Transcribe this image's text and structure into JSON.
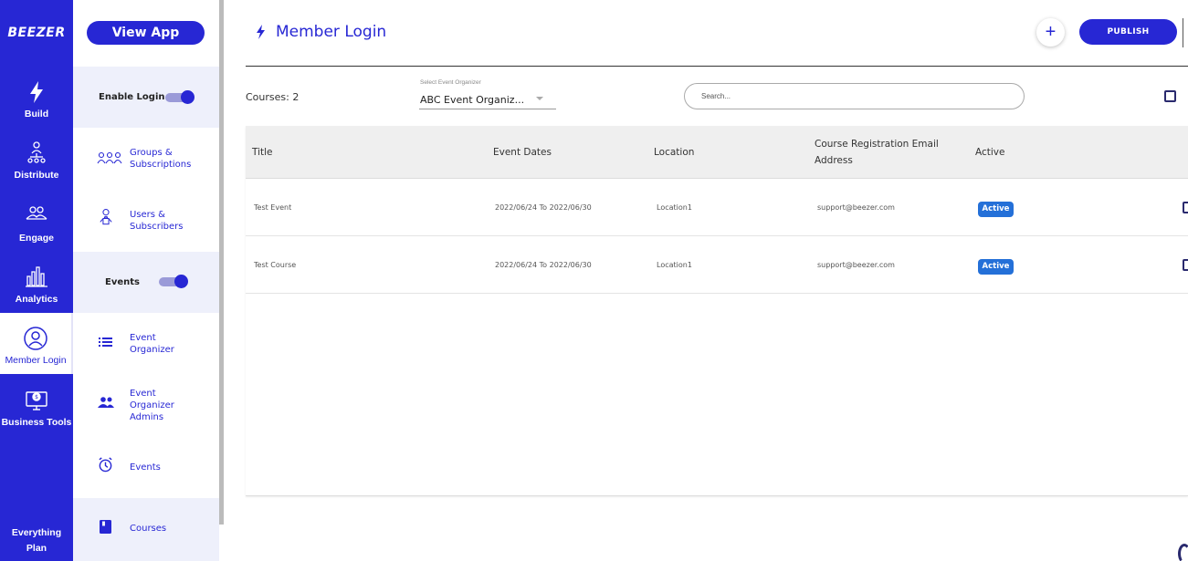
{
  "rail": {
    "logo": "BEEZER",
    "items": [
      {
        "label": "Build",
        "icon": "bolt-icon"
      },
      {
        "label": "Distribute",
        "icon": "distribute-icon"
      },
      {
        "label": "Engage",
        "icon": "engage-icon"
      },
      {
        "label": "Analytics",
        "icon": "analytics-icon"
      },
      {
        "label": "Member Login",
        "icon": "member-login-icon"
      },
      {
        "label": "Business Tools",
        "icon": "business-tools-icon"
      }
    ],
    "plan_line1": "Everything",
    "plan_line2": "Plan"
  },
  "sidebar": {
    "view_app": "View App",
    "enable_login": "Enable Login",
    "groups_line1": "Groups &",
    "groups_line2": "Subscriptions",
    "users_line1": "Users &",
    "users_line2": "Subscribers",
    "events_section": "Events",
    "event_org_line1": "Event",
    "event_org_line2": "Organizer",
    "admins_line1": "Event",
    "admins_line2": "Organizer",
    "admins_line3": "Admins",
    "events_item": "Events",
    "courses_item": "Courses"
  },
  "header": {
    "title": "Member Login",
    "add_symbol": "+",
    "publish": "PUBLISH"
  },
  "filters": {
    "courses_count": "Courses: 2",
    "organizer_label": "Select Event Organizer",
    "organizer_value": "ABC Event Organiz...",
    "search_placeholder": "Search..."
  },
  "table": {
    "columns": [
      "Title",
      "Event Dates",
      "Location",
      "Course Registration Email",
      "Address",
      "Active"
    ],
    "rows": [
      {
        "title": "Test Event",
        "dates": "2022/06/24 To 2022/06/30",
        "location": "Location1",
        "email": "support@beezer.com",
        "status": "Active"
      },
      {
        "title": "Test Course",
        "dates": "2022/06/24 To 2022/06/30",
        "location": "Location1",
        "email": "support@beezer.com",
        "status": "Active"
      }
    ]
  },
  "colors": {
    "brand": "#2727d4",
    "badge": "#2470d8",
    "section_bg": "#eef0fb"
  }
}
